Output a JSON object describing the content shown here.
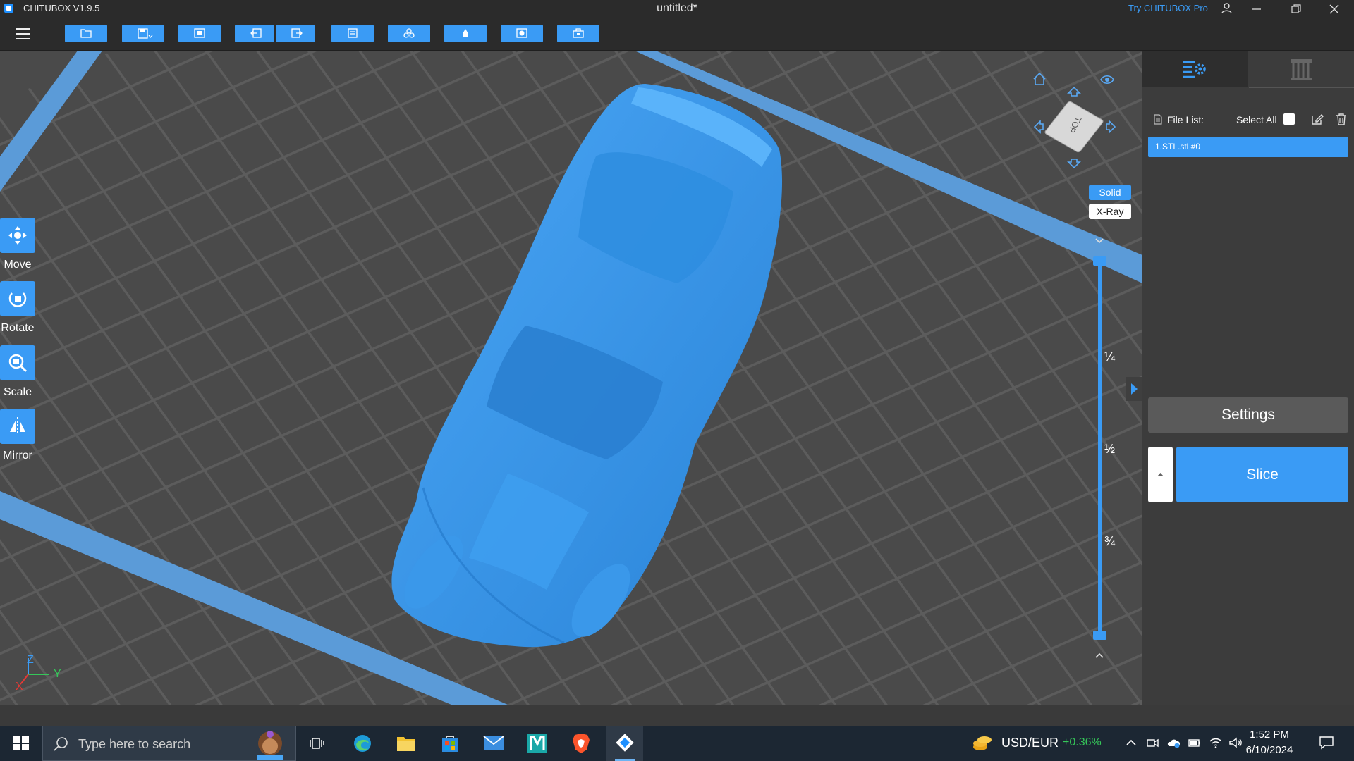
{
  "app": {
    "name": "CHITUBOX V1.9.5",
    "window_title": "untitled*",
    "try_pro": "Try CHITUBOX Pro"
  },
  "left_tools": [
    {
      "label": "Move",
      "icon": "move-icon"
    },
    {
      "label": "Rotate",
      "icon": "rotate-icon"
    },
    {
      "label": "Scale",
      "icon": "scale-icon"
    },
    {
      "label": "Mirror",
      "icon": "mirror-icon"
    }
  ],
  "view": {
    "cube_label": "TOP",
    "modes": {
      "solid": "Solid",
      "xray": "X-Ray"
    },
    "active_mode": "solid",
    "layer_marks": [
      "¼",
      "½",
      "¾"
    ],
    "axes": {
      "z": "Z",
      "y": "Y",
      "x": "X"
    }
  },
  "right_panel": {
    "file_list_label": "File List:",
    "select_all_label": "Select All",
    "files": [
      "1.STL.stl #0"
    ],
    "settings_label": "Settings",
    "slice_label": "Slice"
  },
  "taskbar": {
    "search_placeholder": "Type here to search",
    "tray": {
      "currency": "USD/EUR",
      "change": "+0.36%"
    },
    "clock": {
      "time": "1:52 PM",
      "date": "6/10/2024"
    }
  },
  "colors": {
    "accent": "#3a9bf5",
    "viewport": "#4a4a4a",
    "model": "#3b96e8",
    "plate_edge": "#5b9bd8"
  }
}
